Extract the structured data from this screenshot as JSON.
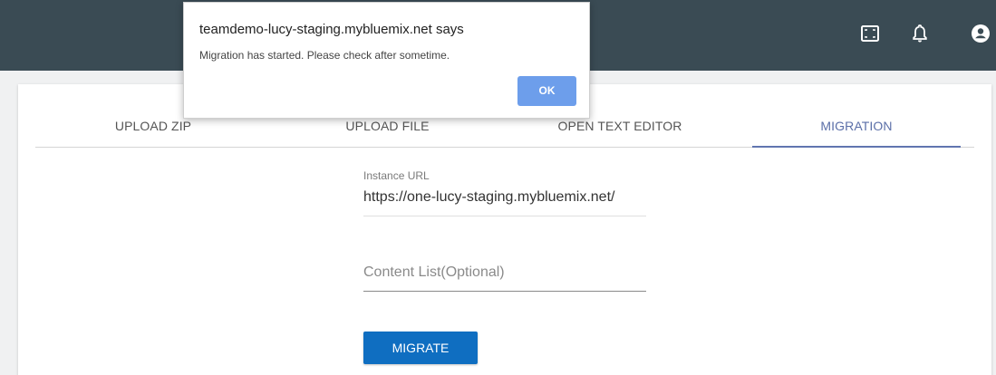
{
  "topbar": {
    "icons": [
      "fullscreen-icon",
      "notification-bell-icon",
      "account-icon"
    ],
    "background": "#3a4b54"
  },
  "tabs": [
    {
      "label": "UPLOAD ZIP",
      "active": false
    },
    {
      "label": "UPLOAD FILE",
      "active": false
    },
    {
      "label": "OPEN TEXT EDITOR",
      "active": false
    },
    {
      "label": "MIGRATION",
      "active": true
    }
  ],
  "form": {
    "instance_url_label": "Instance URL",
    "instance_url_value": "https://one-lucy-staging.mybluemix.net/",
    "content_list_placeholder": "Content List(Optional)",
    "migrate_label": "MIGRATE"
  },
  "dialog": {
    "title": "teamdemo-lucy-staging.mybluemix.net says",
    "message": "Migration has started. Please check after sometime.",
    "ok_label": "OK"
  },
  "colors": {
    "accent": "#5b6fa8",
    "button": "#0f6ec1",
    "dialog_ok": "#6d9eeb"
  }
}
